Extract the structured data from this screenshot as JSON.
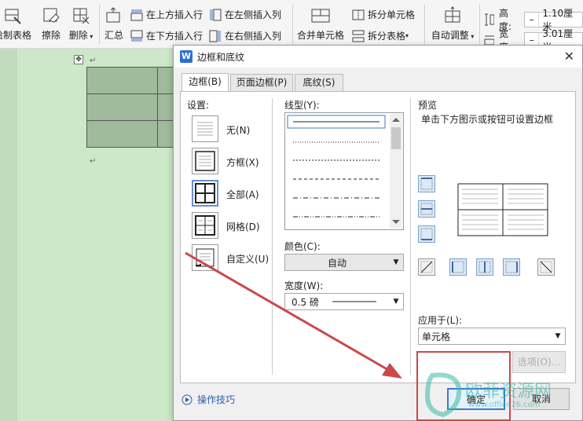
{
  "ribbon": {
    "draw_table": "绘制表格",
    "eraser": "擦除",
    "delete": "删除",
    "summary": "汇总",
    "insert_row_above": "在上方插入行",
    "insert_row_below": "在下方插入行",
    "insert_col_left": "在左侧插入列",
    "insert_col_right": "在右侧插入列",
    "merge_cells": "合并单元格",
    "split_cells": "拆分单元格",
    "split_table": "拆分表格",
    "auto_adjust": "自动调整",
    "height_label": "高度:",
    "height_value": "1.10厘米",
    "width_label": "宽度:",
    "width_value": "3.01厘米",
    "minus": "–"
  },
  "doc": {
    "para_mark": "↵"
  },
  "dialog": {
    "logo": "W",
    "title": "边框和底纹",
    "close": "✕",
    "tabs": [
      "边框(B)",
      "页面边框(P)",
      "底纹(S)"
    ],
    "settings_label": "设置:",
    "settings": [
      "无(N)",
      "方框(X)",
      "全部(A)",
      "网格(D)",
      "自定义(U)"
    ],
    "line_style_label": "线型(Y):",
    "color_label": "颜色(C):",
    "color_value": "自动",
    "width_label": "宽度(W):",
    "width_value": "0.5   磅",
    "preview_label": "预览",
    "preview_hint": "单击下方图示或按钮可设置边框",
    "apply_to_label": "应用于(L):",
    "apply_to_value": "单元格",
    "options_button": "选项(O)...",
    "tips": "操作技巧",
    "ok": "确定",
    "cancel": "取消"
  },
  "watermark": {
    "brand": "欧菲资源网",
    "url": "www.office26.com"
  },
  "colors": {
    "doc_bg": "#cfe6cc",
    "cell_fill": "#9fbb9b",
    "highlight": "#c94a4a",
    "arrow": "#c94a4a",
    "accent": "#3b7bd1"
  }
}
